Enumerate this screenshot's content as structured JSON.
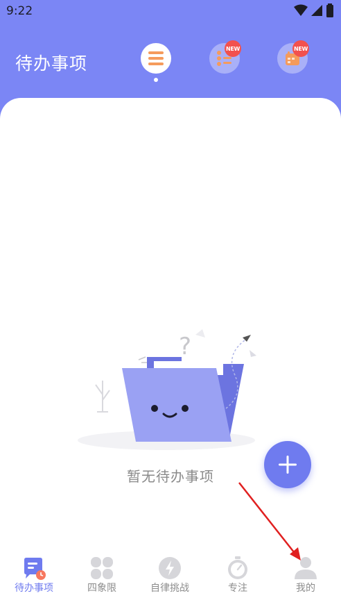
{
  "status_bar": {
    "time": "9:22"
  },
  "header": {
    "title": "待办事项",
    "badges": [
      "NEW",
      "NEW"
    ]
  },
  "empty_state": {
    "text": "暂无待办事项"
  },
  "bottom_nav": {
    "items": [
      {
        "label": "待办事项",
        "icon": "todo-icon",
        "active": true
      },
      {
        "label": "四象限",
        "icon": "quadrant-icon",
        "active": false
      },
      {
        "label": "自律挑战",
        "icon": "challenge-icon",
        "active": false
      },
      {
        "label": "专注",
        "icon": "timer-icon",
        "active": false
      },
      {
        "label": "我的",
        "icon": "profile-icon",
        "active": false
      }
    ]
  },
  "colors": {
    "accent": "#7b86f5",
    "fab": "#6f7bef",
    "badge": "#f2514e",
    "annotation_arrow": "#e02020"
  }
}
